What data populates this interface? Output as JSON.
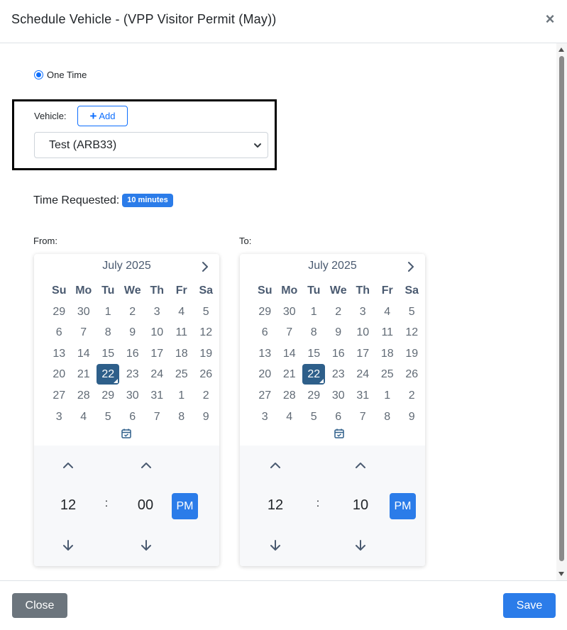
{
  "modal": {
    "title": "Schedule Vehicle - (VPP Visitor Permit (May))",
    "close_symbol": "×"
  },
  "schedule_type": {
    "label": "One Time",
    "selected": true
  },
  "vehicle": {
    "label": "Vehicle:",
    "add_label": "Add",
    "selected": "Test (ARB33)"
  },
  "time_requested": {
    "label": "Time Requested:",
    "badge": "10 minutes"
  },
  "from": {
    "label": "From:",
    "month": "July 2025",
    "selected_day": "22",
    "hour": "12",
    "separator": ":",
    "minute": "00",
    "meridiem": "PM"
  },
  "to": {
    "label": "To:",
    "month": "July 2025",
    "selected_day": "22",
    "hour": "12",
    "separator": ":",
    "minute": "10",
    "meridiem": "PM"
  },
  "calendar": {
    "weekdays": [
      "Su",
      "Mo",
      "Tu",
      "We",
      "Th",
      "Fr",
      "Sa"
    ],
    "weeks": [
      [
        "29",
        "30",
        "1",
        "2",
        "3",
        "4",
        "5"
      ],
      [
        "6",
        "7",
        "8",
        "9",
        "10",
        "11",
        "12"
      ],
      [
        "13",
        "14",
        "15",
        "16",
        "17",
        "18",
        "19"
      ],
      [
        "20",
        "21",
        "22",
        "23",
        "24",
        "25",
        "26"
      ],
      [
        "27",
        "28",
        "29",
        "30",
        "31",
        "1",
        "2"
      ],
      [
        "3",
        "4",
        "5",
        "6",
        "7",
        "8",
        "9"
      ]
    ]
  },
  "footer": {
    "close_label": "Close",
    "save_label": "Save"
  },
  "colors": {
    "primary": "#2b7ce9",
    "selected_day": "#2e5f8a",
    "secondary": "#6c757d"
  }
}
